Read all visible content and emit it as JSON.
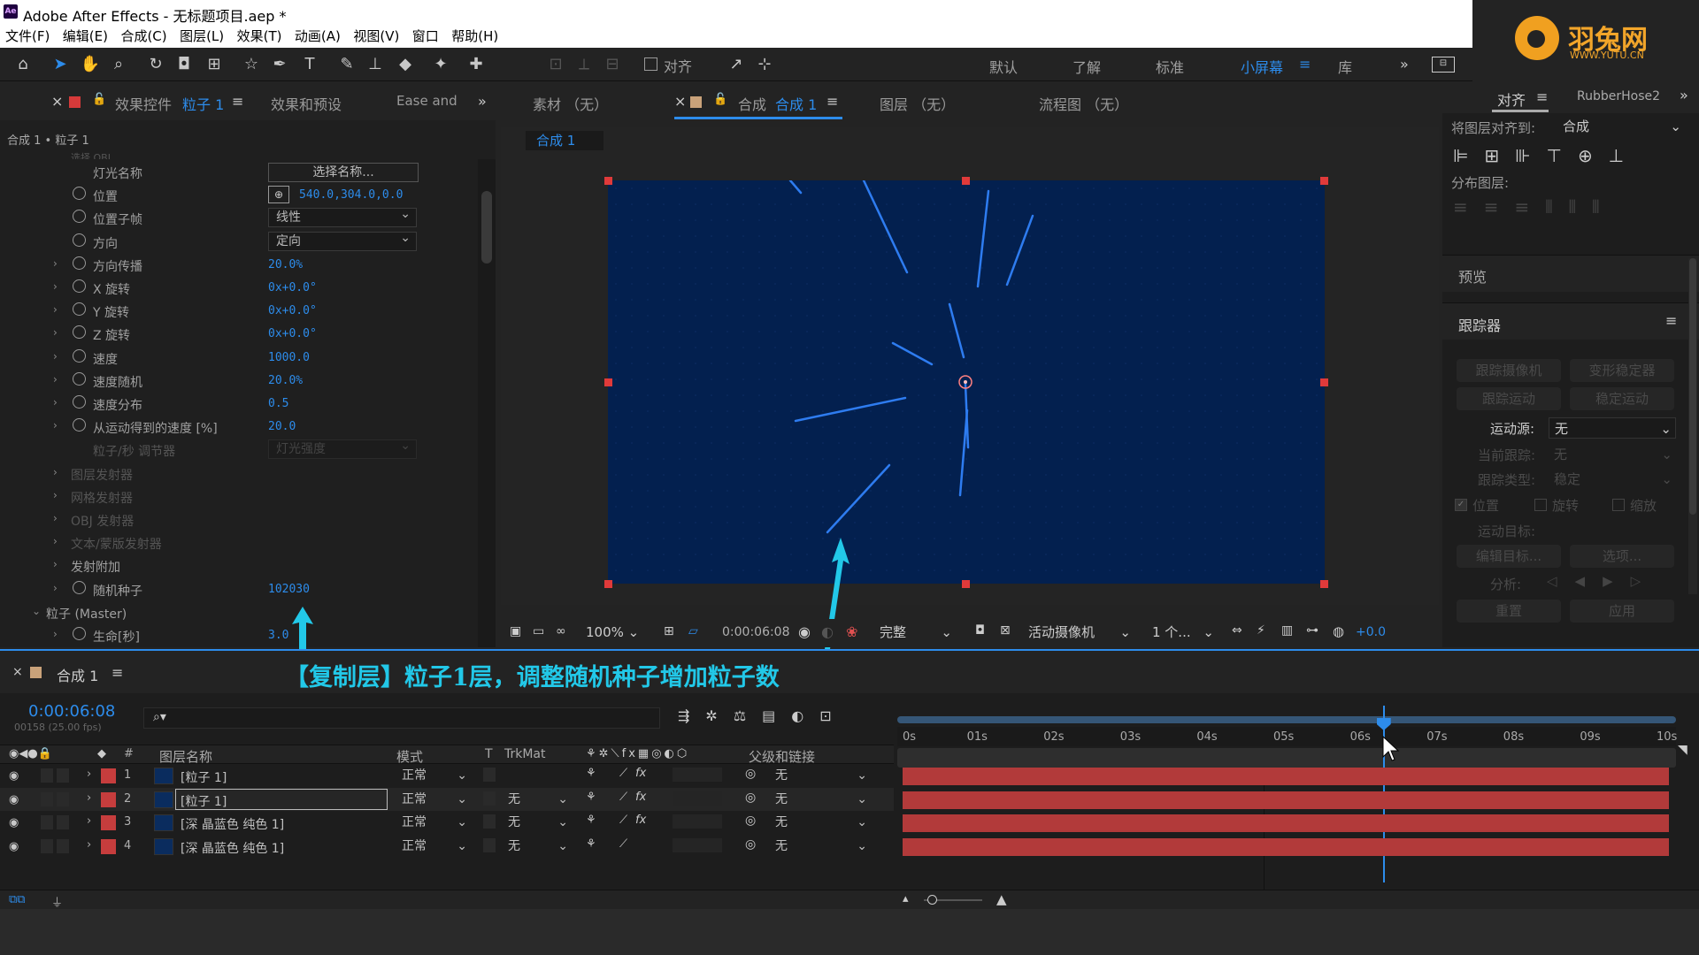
{
  "app": {
    "icon_text": "Ae",
    "title": "Adobe After Effects - 无标题项目.aep *"
  },
  "menu": [
    "文件(F)",
    "编辑(E)",
    "合成(C)",
    "图层(L)",
    "效果(T)",
    "动画(A)",
    "视图(V)",
    "窗口",
    "帮助(H)"
  ],
  "brand": {
    "name": "羽兔网",
    "url": "WWW.YUTU.CN"
  },
  "toolbar": {
    "snap_label": "对齐",
    "workspaces": [
      "默认",
      "了解",
      "标准",
      "小屏幕",
      "库"
    ],
    "active_workspace": "小屏幕"
  },
  "left_panel": {
    "tabs": {
      "effects_controls": "效果控件",
      "layer_name": "粒子 1",
      "effects_presets": "效果和预设",
      "ease": "Ease and"
    },
    "breadcrumb": "合成 1 • 粒子 1",
    "faded_top": "选择 OBJ",
    "properties": [
      {
        "label": "灯光名称",
        "value": "选择名称...",
        "kind": "button"
      },
      {
        "label": "位置",
        "value": "540.0,304.0,0.0",
        "kind": "point"
      },
      {
        "label": "位置子帧",
        "value": "线性",
        "kind": "dropdown"
      },
      {
        "label": "方向",
        "value": "定向",
        "kind": "dropdown"
      },
      {
        "label": "方向传播",
        "value": "20.0%",
        "kind": "value",
        "chev": true
      },
      {
        "label": "X 旋转",
        "value": "0x+0.0°",
        "kind": "value",
        "chev": true
      },
      {
        "label": "Y 旋转",
        "value": "0x+0.0°",
        "kind": "value",
        "chev": true
      },
      {
        "label": "Z 旋转",
        "value": "0x+0.0°",
        "kind": "value",
        "chev": true
      },
      {
        "label": "速度",
        "value": "1000.0",
        "kind": "value",
        "chev": true
      },
      {
        "label": "速度随机",
        "value": "20.0%",
        "kind": "value",
        "chev": true
      },
      {
        "label": "速度分布",
        "value": "0.5",
        "kind": "value",
        "chev": true
      },
      {
        "label": "从运动得到的速度 [%]",
        "value": "20.0",
        "kind": "value",
        "chev": true
      },
      {
        "label": "粒子/秒 调节器",
        "value": "灯光强度",
        "kind": "dimdrop"
      },
      {
        "label": "图层发射器",
        "kind": "group-dim"
      },
      {
        "label": "网格发射器",
        "kind": "group-dim"
      },
      {
        "label": "OBJ 发射器",
        "kind": "group-dim"
      },
      {
        "label": "文本/蒙版发射器",
        "kind": "group-dim"
      },
      {
        "label": "发射附加",
        "kind": "group"
      },
      {
        "label": "随机种子",
        "value": "102030",
        "kind": "value",
        "chev": true
      },
      {
        "label": "粒子 (Master)",
        "kind": "section"
      },
      {
        "label": "生命[秒]",
        "value": "3.0",
        "kind": "value",
        "chev": true
      }
    ]
  },
  "center_panel": {
    "tabs": {
      "footage": "素材 （无）",
      "comp_prefix": "合成",
      "comp_name": "合成 1",
      "layer": "图层 （无）",
      "flowchart": "流程图 （无）"
    },
    "comp_chip": "合成 1",
    "viewer_bar": {
      "zoom": "100%",
      "timecode": "0:00:06:08",
      "quality": "完整",
      "camera": "活动摄像机",
      "views": "1 个...",
      "exposure": "+0.0"
    },
    "comp_bg": "#03204f"
  },
  "right_panel": {
    "tabs": {
      "align": "对齐",
      "rubberhose": "RubberHose2"
    },
    "align_to_label": "将图层对齐到:",
    "align_to_value": "合成",
    "distribute_label": "分布图层:",
    "preview": "预览",
    "tracker": "跟踪器",
    "tracker_buttons": [
      "跟踪摄像机",
      "变形稳定器",
      "跟踪运动",
      "稳定运动"
    ],
    "motion_source_label": "运动源:",
    "motion_source_value": "无",
    "current_track_label": "当前跟踪:",
    "current_track_value": "无",
    "track_type_label": "跟踪类型:",
    "track_type_value": "稳定",
    "checks": [
      "位置",
      "旋转",
      "缩放"
    ],
    "motion_target": "运动目标:",
    "edit_target": "编辑目标...",
    "options": "选项...",
    "analyze": "分析:",
    "reset": "重置",
    "apply": "应用"
  },
  "timeline": {
    "tab": "合成 1",
    "annotation": "【复制层】粒子1层，调整随机种子增加粒子数",
    "timecode": "0:00:06:08",
    "frames": "00158 (25.00 fps)",
    "columns": {
      "num": "#",
      "name": "图层名称",
      "mode": "模式",
      "t": "T",
      "trkmat": "TrkMat",
      "parent": "父级和链接"
    },
    "ruler": [
      "0s",
      "01s",
      "02s",
      "03s",
      "04s",
      "05s",
      "06s",
      "07s",
      "08s",
      "09s",
      "10s"
    ],
    "playhead_fraction": 0.6267,
    "layers": [
      {
        "num": "1",
        "name": "[粒子 1]",
        "mode": "正常",
        "trkmat": "",
        "parent": "无"
      },
      {
        "num": "2",
        "name": "[粒子 1]",
        "mode": "正常",
        "trkmat": "无",
        "parent": "无"
      },
      {
        "num": "3",
        "name": "[深 晶蓝色 纯色 1]",
        "mode": "正常",
        "trkmat": "无",
        "parent": "无"
      },
      {
        "num": "4",
        "name": "[深 晶蓝色 纯色 1]",
        "mode": "正常",
        "trkmat": "无",
        "parent": "无"
      }
    ]
  }
}
